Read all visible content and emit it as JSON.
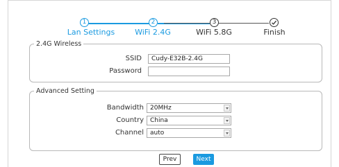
{
  "stepper": {
    "steps": [
      {
        "number": "1",
        "label": "Lan Settings",
        "state": "active"
      },
      {
        "number": "2",
        "label": "WiFi 2.4G",
        "state": "active"
      },
      {
        "number": "3",
        "label": "WiFi 5.8G",
        "state": "pending"
      },
      {
        "number": "",
        "label": "Finish",
        "state": "final",
        "icon": "check-icon"
      }
    ],
    "colors": {
      "active": "#1a9ae0",
      "pending": "#333333"
    }
  },
  "wireless": {
    "legend": "2.4G Wireless",
    "ssid_label": "SSID",
    "ssid_value": "Cudy-E32B-2.4G",
    "password_label": "Password",
    "password_value": ""
  },
  "advanced": {
    "legend": "Advanced Setting",
    "bandwidth_label": "Bandwidth",
    "bandwidth_value": "20MHz",
    "country_label": "Country",
    "country_value": "China",
    "channel_label": "Channel",
    "channel_value": "auto"
  },
  "buttons": {
    "prev_label": "Prev",
    "next_label": "Next"
  }
}
